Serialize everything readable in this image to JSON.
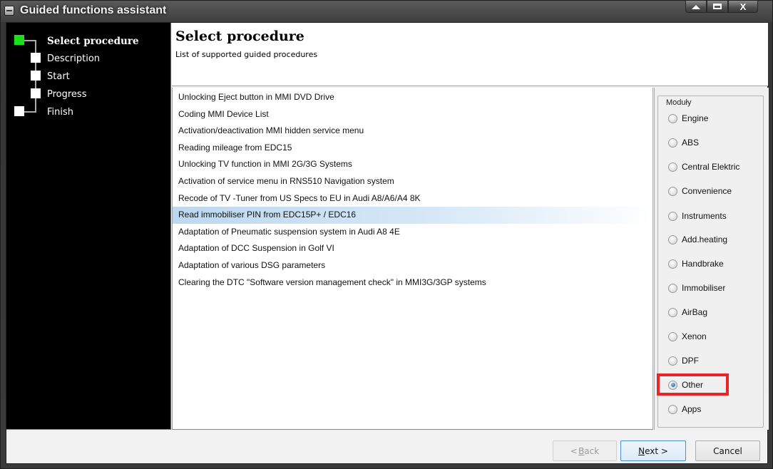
{
  "window": {
    "title": "Guided functions assistant",
    "controls": [
      "minimize",
      "maximize",
      "close"
    ]
  },
  "steps": [
    {
      "label": "Select procedure",
      "active": true
    },
    {
      "label": "Description",
      "active": false
    },
    {
      "label": "Start",
      "active": false
    },
    {
      "label": "Progress",
      "active": false
    },
    {
      "label": "Finish",
      "active": false
    }
  ],
  "header": {
    "title": "Select procedure",
    "subtitle": "List of supported guided procedures"
  },
  "procedures": {
    "selected_index": 7,
    "items": [
      "Unlocking Eject button in MMI DVD Drive",
      "Coding MMI Device List",
      "Activation/deactivation MMI hidden service menu",
      "Reading mileage from EDC15",
      "Unlocking TV function in MMI 2G/3G Systems",
      "Activation of service menu in RNS510 Navigation system",
      "Recode of TV -Tuner from US Specs to EU in Audi A8/A6/A4 8K",
      "Read immobiliser PIN from EDC15P+ / EDC16",
      "Adaptation of Pneumatic suspension system in Audi A8 4E",
      "Adaptation of DCC Suspension in Golf VI",
      "Adaptation of various DSG parameters",
      "Clearing the DTC \"Software version management check\" in MMI3G/3GP systems"
    ]
  },
  "modules": {
    "title": "Moduły",
    "selected": "Other",
    "options": [
      "Engine",
      "ABS",
      "Central Elektric",
      "Convenience",
      "Instruments",
      "Add.heating",
      "Handbrake",
      "Immobiliser",
      "AirBag",
      "Xenon",
      "DPF",
      "Other",
      "Apps"
    ]
  },
  "buttons": {
    "back": {
      "prefix": "< ",
      "mnemonic": "B",
      "rest": "ack",
      "enabled": false
    },
    "next": {
      "mnemonic": "N",
      "rest": "ext >",
      "enabled": true
    },
    "cancel": {
      "label": "Cancel",
      "enabled": true
    }
  },
  "colors": {
    "active_step": "#19e019",
    "selection": "#bcd8ef",
    "highlight": "#e8262a"
  }
}
